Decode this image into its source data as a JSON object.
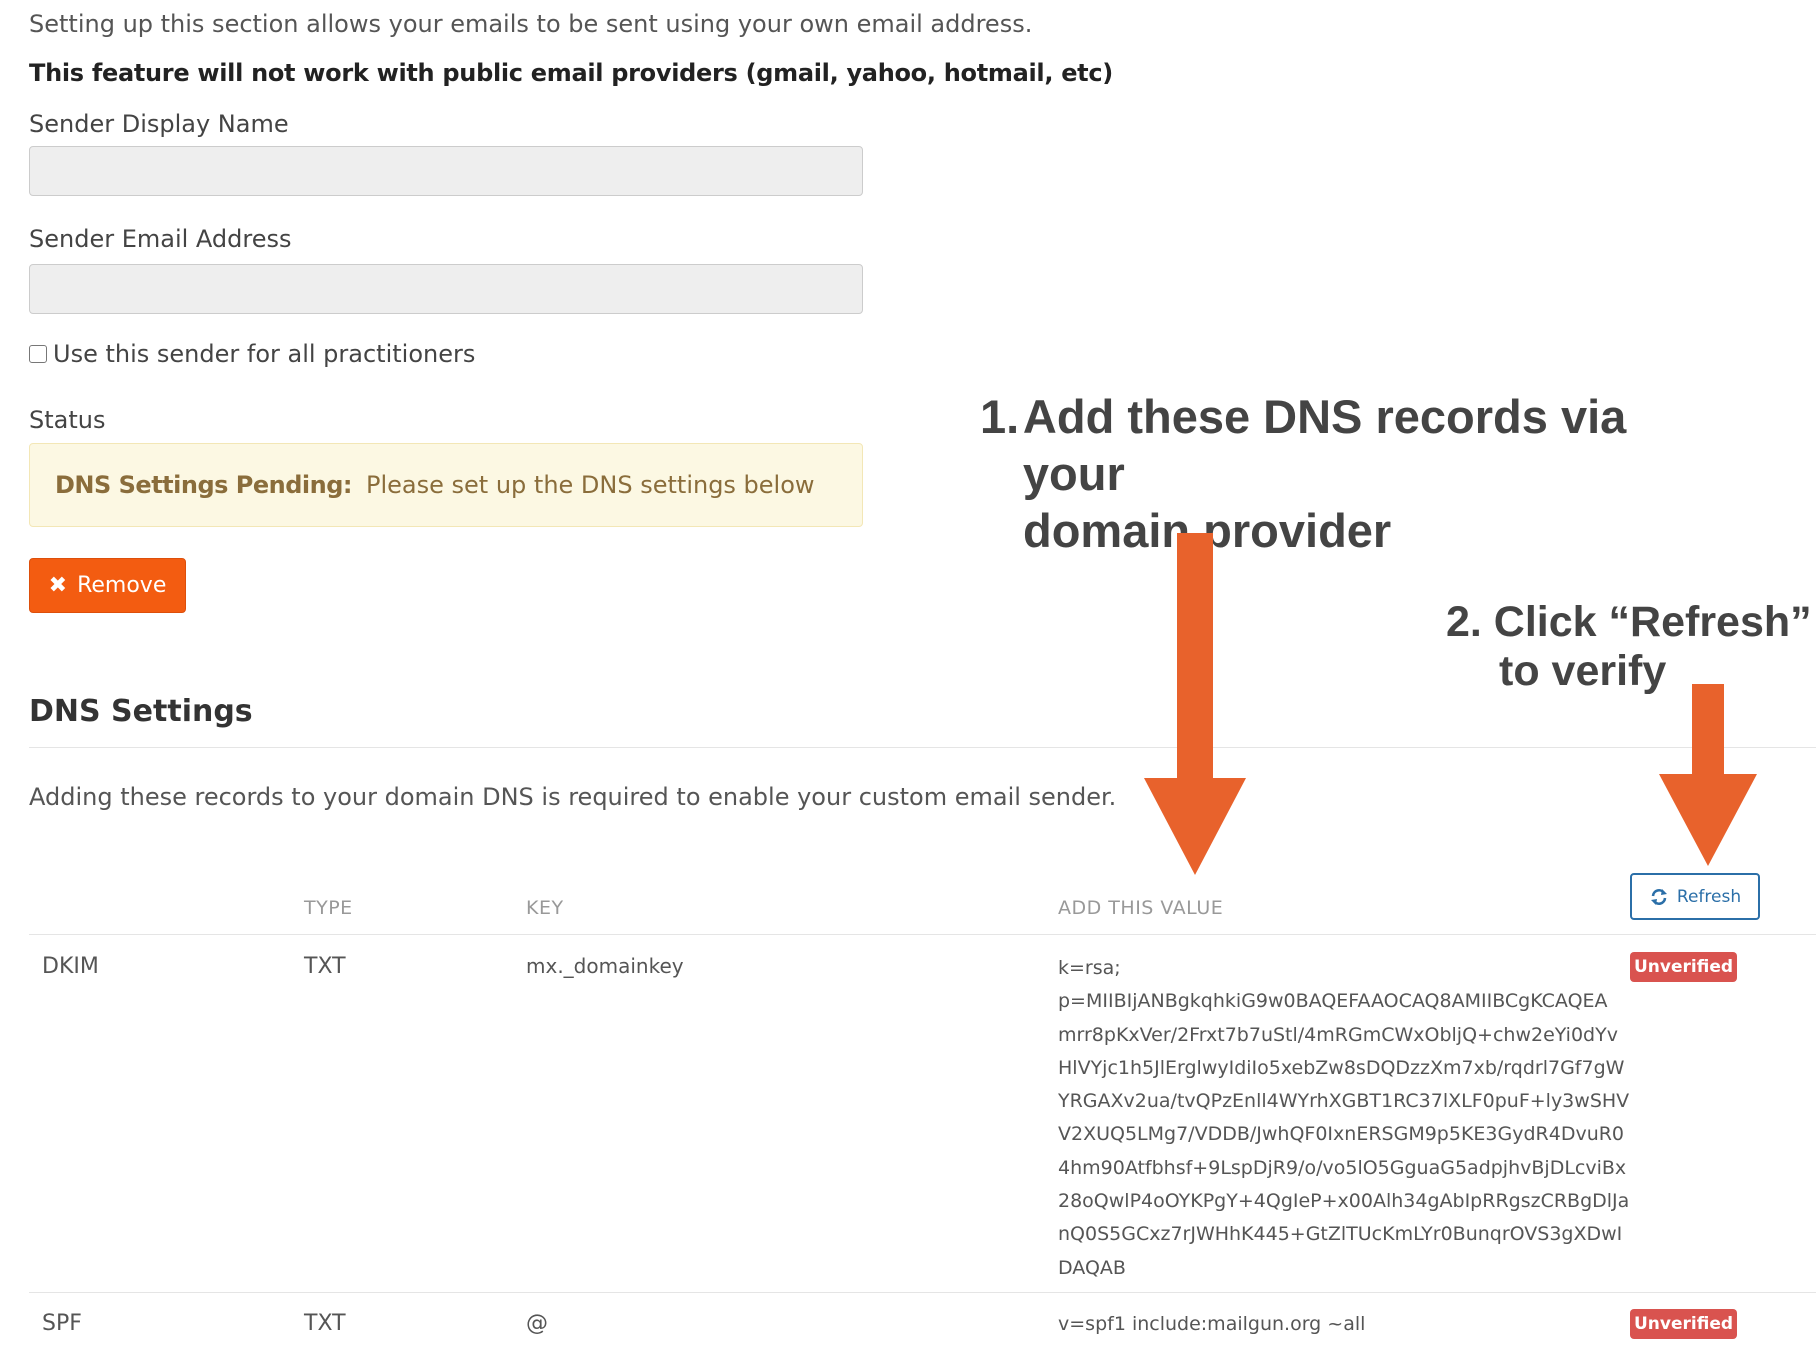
{
  "intro_text": "Setting up this section allows your emails to be sent using your own email address.",
  "warning_text": "This feature will not work with public email providers (gmail, yahoo, hotmail, etc)",
  "form": {
    "display_name_label": "Sender Display Name",
    "display_name_value": "",
    "email_label": "Sender Email Address",
    "email_value": "",
    "use_for_all_label": "Use this sender for all practitioners",
    "use_for_all_checked": false,
    "status_label": "Status"
  },
  "status_alert": {
    "title": "DNS Settings Pending:",
    "message": "Please set up the DNS settings below",
    "background_color": "#fcf8e3"
  },
  "remove_button": {
    "icon": "x-icon",
    "label": "Remove",
    "color": "#f35c11"
  },
  "dns": {
    "title": "DNS Settings",
    "description": "Adding these records to your domain DNS is required to enable your custom email sender.",
    "columns": {
      "name": "",
      "type": "TYPE",
      "key": "KEY",
      "value": "ADD THIS VALUE"
    },
    "refresh_button": {
      "icon": "refresh-icon",
      "label": "Refresh",
      "color": "#2b6fa8"
    },
    "records": [
      {
        "name": "DKIM",
        "type": "TXT",
        "key": "mx._domainkey",
        "value_lines": [
          "k=rsa;",
          "p=MIIBIjANBgkqhkiG9w0BAQEFAAOCAQ8AMIIBCgKCAQEA",
          "mrr8pKxVer/2Frxt7b7uStl/4mRGmCWxObljQ+chw2eYi0dYv",
          "HlVYjc1h5JlErglwyIdiIo5xebZw8sDQDzzXm7xb/rqdrl7Gf7gW",
          "YRGAXv2ua/tvQPzEnll4WYrhXGBT1RC37lXLF0puF+ly3wSHV",
          "V2XUQ5LMg7/VDDB/JwhQF0IxnERSGM9p5KE3GydR4DvuR0",
          "4hm90Atfbhsf+9LspDjR9/o/vo5lO5GguaG5adpjhvBjDLcviBx",
          "28oQwlP4oOYKPgY+4QgIeP+x00Alh34gAbIpRRgszCRBgDlJa",
          "nQ0S5GCxz7rJWHhK445+GtZlTUcKmLYr0BunqrOVS3gXDwI",
          "DAQAB"
        ],
        "status": "Unverified"
      },
      {
        "name": "SPF",
        "type": "TXT",
        "key": "@",
        "value_lines": [
          "v=spf1 include:mailgun.org ~all"
        ],
        "status": "Unverified"
      }
    ],
    "status_color": "#d9534f"
  },
  "annotations": {
    "step1_number": "1.",
    "step1_line1": "Add these DNS records via your",
    "step1_line2": "domain provider",
    "step2_line1": "2. Click “Refresh”",
    "step2_line2": "to verify",
    "arrow_color": "#e8622c"
  }
}
